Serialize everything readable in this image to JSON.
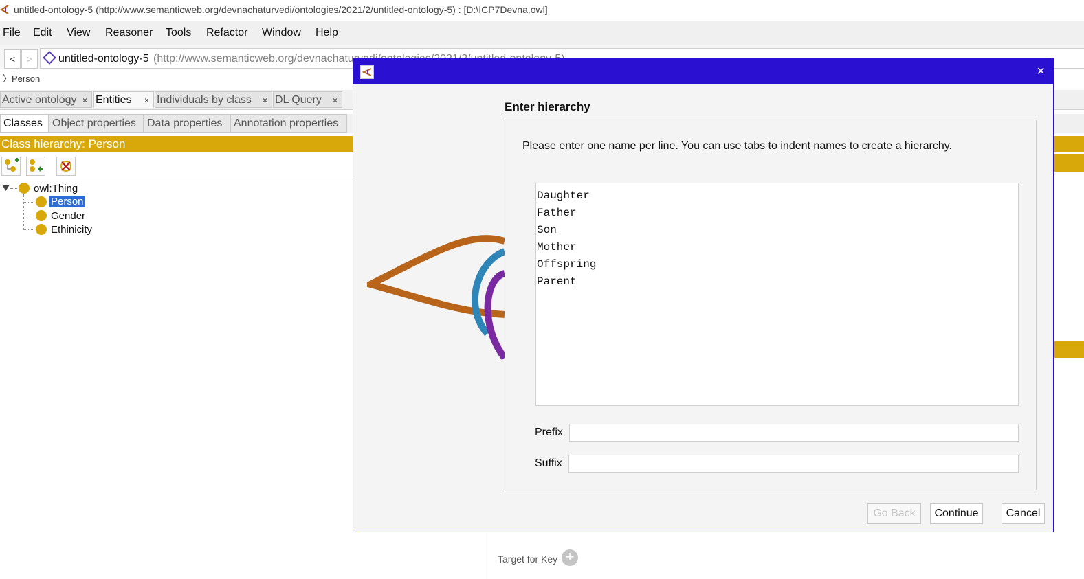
{
  "window": {
    "title": "untitled-ontology-5 (http://www.semanticweb.org/devnachaturvedi/ontologies/2021/2/untitled-ontology-5)  : [D:\\ICP7Devna.owl]"
  },
  "menu": [
    "File",
    "Edit",
    "View",
    "Reasoner",
    "Tools",
    "Refactor",
    "Window",
    "Help"
  ],
  "address": {
    "back": "<",
    "forward": ">",
    "ontology_name": "untitled-ontology-5",
    "iri": "(http://www.semanticweb.org/devnachaturvedi/ontologies/2021/2/untitled-ontology-5)"
  },
  "breadcrumb": "Person",
  "tabs": [
    {
      "label": "Active ontology",
      "close": "×"
    },
    {
      "label": "Entities",
      "close": "×"
    },
    {
      "label": "Individuals by class",
      "close": "×"
    },
    {
      "label": "DL Query",
      "close": "×"
    }
  ],
  "subtabs": [
    "Classes",
    "Object properties",
    "Data properties",
    "Annotation properties"
  ],
  "hierarchy_header": "Class hierarchy: Person",
  "tree": {
    "root": "owl:Thing",
    "children": [
      "Person",
      "Gender",
      "Ethinicity"
    ],
    "selected": "Person"
  },
  "bottom": {
    "target_for_key": "Target for Key",
    "plus": "+"
  },
  "dialog": {
    "close": "×",
    "heading": "Enter hierarchy",
    "instructions": "Please enter one name per line. You can use tabs to indent names to create a hierarchy.",
    "lines": [
      "Daughter",
      "Father",
      "Son",
      "Mother",
      "Offspring",
      "Parent"
    ],
    "prefix_label": "Prefix",
    "suffix_label": "Suffix",
    "prefix_value": "",
    "suffix_value": "",
    "buttons": {
      "back": "Go Back",
      "continue": "Continue",
      "cancel": "Cancel"
    }
  },
  "colors": {
    "accent": "#d8a80a",
    "dialog_title": "#2a10d0",
    "selection": "#2d6bd6"
  }
}
